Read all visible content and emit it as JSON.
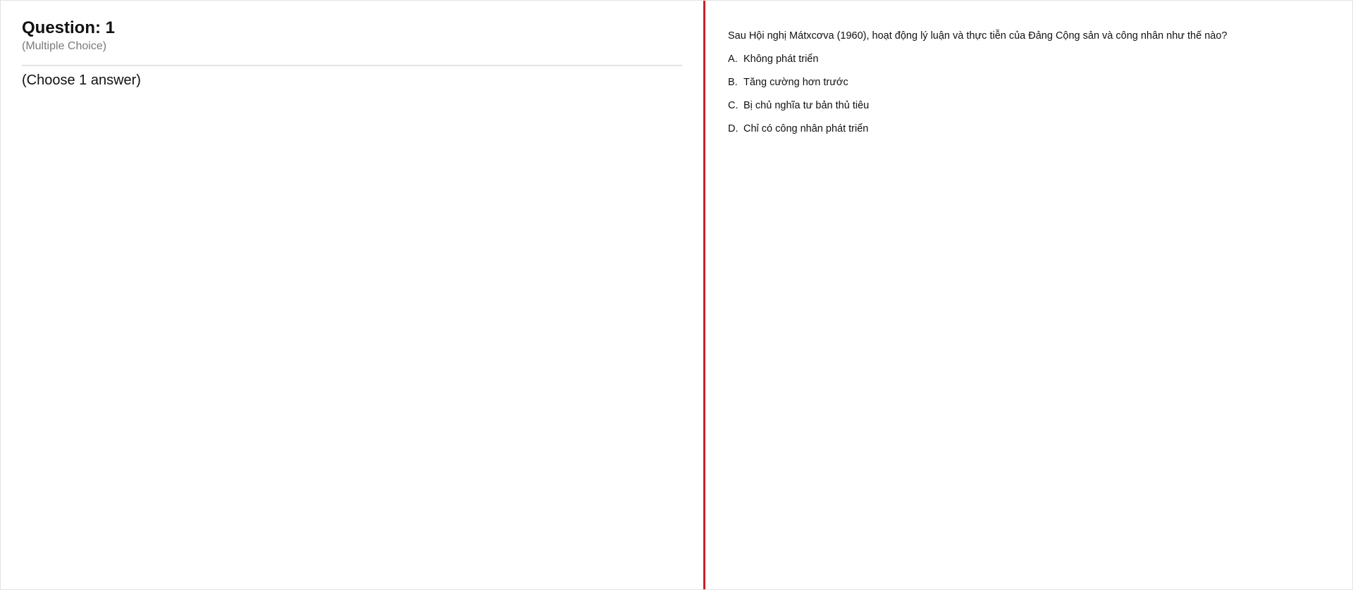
{
  "left": {
    "question_title": "Question: 1",
    "question_type": "(Multiple Choice)",
    "instruction": "(Choose 1 answer)"
  },
  "right": {
    "stem": "Sau Hội nghị Mátxcơva (1960), hoạt động lý luận và thực tiễn của Đảng Cộng sản và công nhân như thế nào?",
    "options": [
      {
        "letter": "A.",
        "text": "Không phát triển"
      },
      {
        "letter": "B.",
        "text": "Tăng cường hơn trước"
      },
      {
        "letter": "C.",
        "text": "Bị chủ nghĩa tư bản thủ tiêu"
      },
      {
        "letter": "D.",
        "text": "Chỉ có công nhân phát triển"
      }
    ]
  },
  "colors": {
    "divider": "#c8202b",
    "muted_text": "#7a7a7a",
    "text": "#111111"
  }
}
